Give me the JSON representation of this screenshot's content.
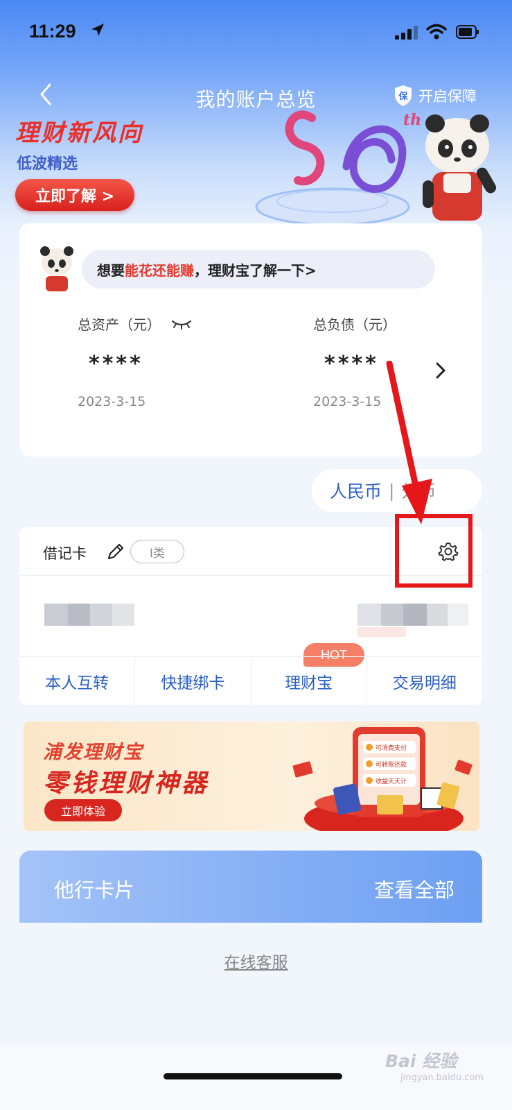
{
  "status_bar": {
    "time": "11:29"
  },
  "nav": {
    "title": "我的账户总览",
    "protect_label": "开启保障",
    "shield_glyph": "保"
  },
  "banner": {
    "title": "理财新风向",
    "subtitle": "低波精选",
    "button": "立即了解 >",
    "badge": "th"
  },
  "asset_card": {
    "promo_prefix": "想要",
    "promo_highlight": "能花还能赚",
    "promo_suffix": "，理财宝了解一下>",
    "total_assets_label": "总资产（元）",
    "total_assets_value": "****",
    "total_assets_date": "2023-3-15",
    "total_liabilities_label": "总负债（元）",
    "total_liabilities_value": "****",
    "total_liabilities_date": "2023-3-15"
  },
  "currency": {
    "rmb": "人民币",
    "separator": "|",
    "fx": "外币"
  },
  "debit_card": {
    "title": "借记卡",
    "class_tag": "I类",
    "hot_badge": "HOT",
    "actions": [
      "本人互转",
      "快捷绑卡",
      "理财宝",
      "交易明细"
    ]
  },
  "ad": {
    "title": "浦发理财宝",
    "subtitle": "零钱理财神器",
    "button": "立即体验",
    "features": [
      "可消费支付",
      "可转账还款",
      "收益天天计"
    ]
  },
  "other_cards": {
    "title": "他行卡片",
    "view_all": "查看全部"
  },
  "footer": {
    "service_link": "在线客服"
  },
  "watermark": {
    "brand": "Bai 经验",
    "url": "jingyan.baidu.com"
  },
  "colors": {
    "accent_blue": "#2a5fc8",
    "brand_red": "#e8382c",
    "annotation_red": "#e5171b"
  }
}
